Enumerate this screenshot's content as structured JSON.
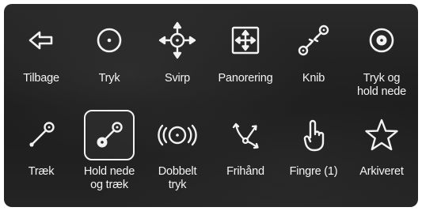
{
  "menu": {
    "items": [
      {
        "label": "Tilbage",
        "icon": "back-arrow-icon"
      },
      {
        "label": "Tryk",
        "icon": "tap-icon"
      },
      {
        "label": "Svirp",
        "icon": "flick-icon"
      },
      {
        "label": "Panorering",
        "icon": "pan-icon"
      },
      {
        "label": "Knib",
        "icon": "pinch-icon"
      },
      {
        "label": "Tryk og\nhold nede",
        "icon": "tap-and-hold-icon"
      },
      {
        "label": "Træk",
        "icon": "drag-icon"
      },
      {
        "label": "Hold nede\nog træk",
        "icon": "hold-and-drag-icon",
        "selected": true
      },
      {
        "label": "Dobbelt\ntryk",
        "icon": "double-tap-icon"
      },
      {
        "label": "Frihånd",
        "icon": "freehand-icon"
      },
      {
        "label": "Fingre (1)",
        "icon": "finger-icon"
      },
      {
        "label": "Arkiveret",
        "icon": "star-icon"
      }
    ]
  },
  "colors": {
    "icon_stroke": "#f2f2f2",
    "label": "#f4f4f4",
    "background": "#222222"
  }
}
